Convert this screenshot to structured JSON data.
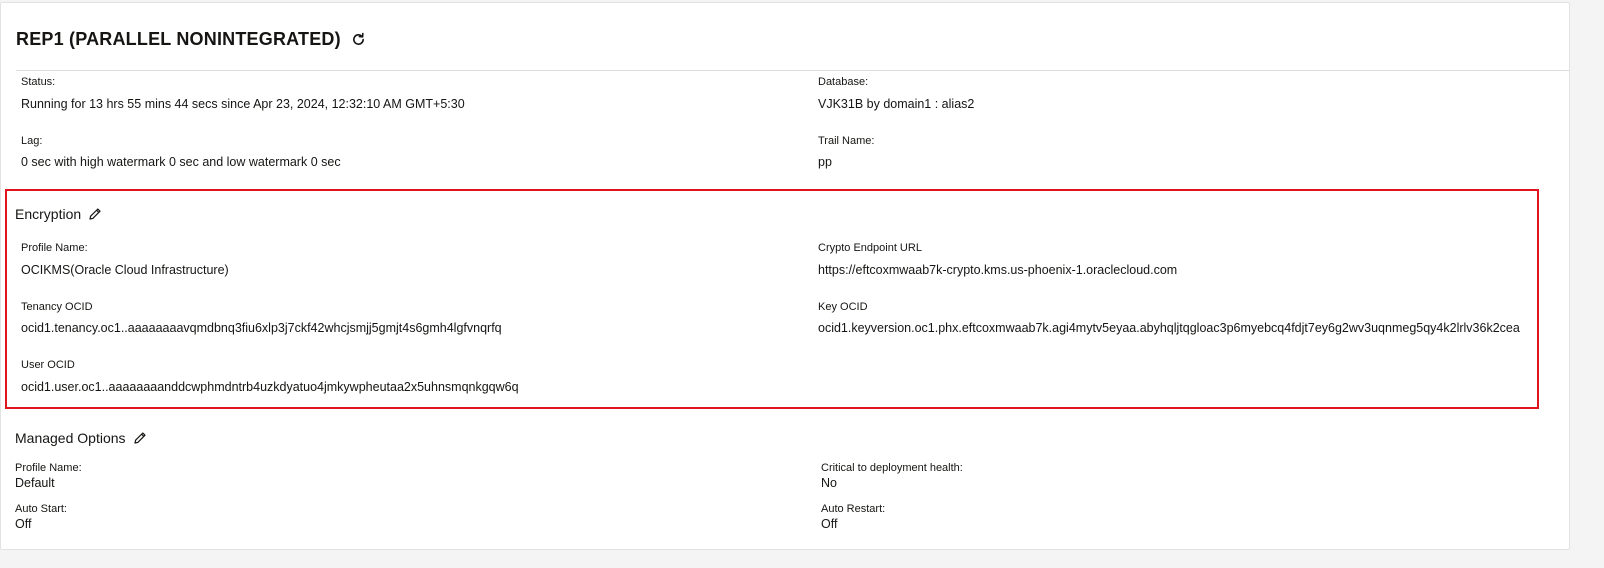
{
  "header": {
    "title": "REP1 (PARALLEL NONINTEGRATED)",
    "refresh_icon": "refresh-icon"
  },
  "overview": {
    "status_label": "Status:",
    "status_value": "Running for 13 hrs 55 mins 44 secs since Apr 23, 2024, 12:32:10 AM GMT+5:30",
    "database_label": "Database:",
    "database_value": "VJK31B by domain1 : alias2",
    "lag_label": "Lag:",
    "lag_value": "0 sec with high watermark 0 sec and low watermark 0 sec",
    "trail_label": "Trail Name:",
    "trail_value": "pp"
  },
  "encryption": {
    "title": "Encryption",
    "edit_icon": "pencil-icon",
    "highlight_color": "#e0141e",
    "profile_name_label": "Profile Name:",
    "profile_name_value": "OCIKMS(Oracle Cloud Infrastructure)",
    "crypto_endpoint_label": "Crypto Endpoint URL",
    "crypto_endpoint_value": "https://eftcoxmwaab7k-crypto.kms.us-phoenix-1.oraclecloud.com",
    "tenancy_ocid_label": "Tenancy OCID",
    "tenancy_ocid_value": "ocid1.tenancy.oc1..aaaaaaaavqmdbnq3fiu6xlp3j7ckf42whcjsmjj5gmjt4s6gmh4lgfvnqrfq",
    "key_ocid_label": "Key OCID",
    "key_ocid_value": "ocid1.keyversion.oc1.phx.eftcoxmwaab7k.agi4mytv5eyaa.abyhqljtqgloac3p6myebcq4fdjt7ey6g2wv3uqnmeg5qy4k2lrlv36k2cea",
    "user_ocid_label": "User OCID",
    "user_ocid_value": "ocid1.user.oc1..aaaaaaaanddcwphmdntrb4uzkdyatuo4jmkywpheutaa2x5uhnsmqnkgqw6q"
  },
  "managed_options": {
    "title": "Managed Options",
    "edit_icon": "pencil-icon",
    "profile_name_label": "Profile Name:",
    "profile_name_value": "Default",
    "critical_label": "Critical to deployment health:",
    "critical_value": "No",
    "auto_start_label": "Auto Start:",
    "auto_start_value": "Off",
    "auto_restart_label": "Auto Restart:",
    "auto_restart_value": "Off"
  }
}
